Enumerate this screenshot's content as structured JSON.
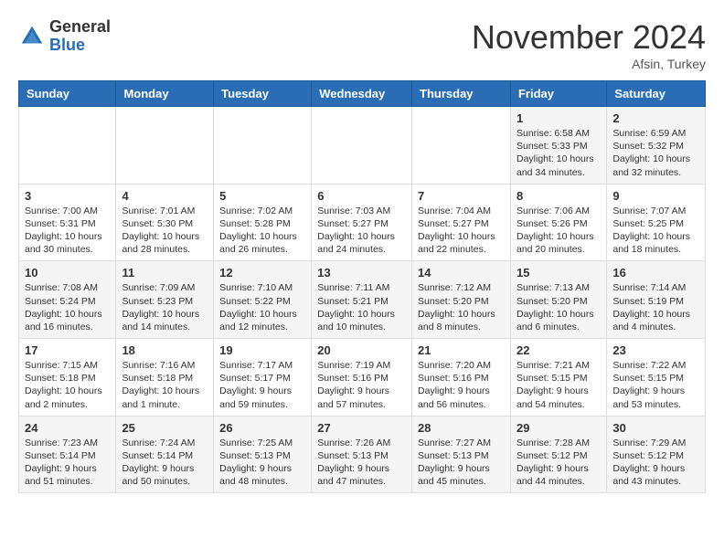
{
  "logo": {
    "general": "General",
    "blue": "Blue"
  },
  "header": {
    "month": "November 2024",
    "location": "Afsin, Turkey"
  },
  "days_of_week": [
    "Sunday",
    "Monday",
    "Tuesday",
    "Wednesday",
    "Thursday",
    "Friday",
    "Saturday"
  ],
  "weeks": [
    [
      {
        "day": "",
        "info": ""
      },
      {
        "day": "",
        "info": ""
      },
      {
        "day": "",
        "info": ""
      },
      {
        "day": "",
        "info": ""
      },
      {
        "day": "",
        "info": ""
      },
      {
        "day": "1",
        "info": "Sunrise: 6:58 AM\nSunset: 5:33 PM\nDaylight: 10 hours\nand 34 minutes."
      },
      {
        "day": "2",
        "info": "Sunrise: 6:59 AM\nSunset: 5:32 PM\nDaylight: 10 hours\nand 32 minutes."
      }
    ],
    [
      {
        "day": "3",
        "info": "Sunrise: 7:00 AM\nSunset: 5:31 PM\nDaylight: 10 hours\nand 30 minutes."
      },
      {
        "day": "4",
        "info": "Sunrise: 7:01 AM\nSunset: 5:30 PM\nDaylight: 10 hours\nand 28 minutes."
      },
      {
        "day": "5",
        "info": "Sunrise: 7:02 AM\nSunset: 5:28 PM\nDaylight: 10 hours\nand 26 minutes."
      },
      {
        "day": "6",
        "info": "Sunrise: 7:03 AM\nSunset: 5:27 PM\nDaylight: 10 hours\nand 24 minutes."
      },
      {
        "day": "7",
        "info": "Sunrise: 7:04 AM\nSunset: 5:27 PM\nDaylight: 10 hours\nand 22 minutes."
      },
      {
        "day": "8",
        "info": "Sunrise: 7:06 AM\nSunset: 5:26 PM\nDaylight: 10 hours\nand 20 minutes."
      },
      {
        "day": "9",
        "info": "Sunrise: 7:07 AM\nSunset: 5:25 PM\nDaylight: 10 hours\nand 18 minutes."
      }
    ],
    [
      {
        "day": "10",
        "info": "Sunrise: 7:08 AM\nSunset: 5:24 PM\nDaylight: 10 hours\nand 16 minutes."
      },
      {
        "day": "11",
        "info": "Sunrise: 7:09 AM\nSunset: 5:23 PM\nDaylight: 10 hours\nand 14 minutes."
      },
      {
        "day": "12",
        "info": "Sunrise: 7:10 AM\nSunset: 5:22 PM\nDaylight: 10 hours\nand 12 minutes."
      },
      {
        "day": "13",
        "info": "Sunrise: 7:11 AM\nSunset: 5:21 PM\nDaylight: 10 hours\nand 10 minutes."
      },
      {
        "day": "14",
        "info": "Sunrise: 7:12 AM\nSunset: 5:20 PM\nDaylight: 10 hours\nand 8 minutes."
      },
      {
        "day": "15",
        "info": "Sunrise: 7:13 AM\nSunset: 5:20 PM\nDaylight: 10 hours\nand 6 minutes."
      },
      {
        "day": "16",
        "info": "Sunrise: 7:14 AM\nSunset: 5:19 PM\nDaylight: 10 hours\nand 4 minutes."
      }
    ],
    [
      {
        "day": "17",
        "info": "Sunrise: 7:15 AM\nSunset: 5:18 PM\nDaylight: 10 hours\nand 2 minutes."
      },
      {
        "day": "18",
        "info": "Sunrise: 7:16 AM\nSunset: 5:18 PM\nDaylight: 10 hours\nand 1 minute."
      },
      {
        "day": "19",
        "info": "Sunrise: 7:17 AM\nSunset: 5:17 PM\nDaylight: 9 hours\nand 59 minutes."
      },
      {
        "day": "20",
        "info": "Sunrise: 7:19 AM\nSunset: 5:16 PM\nDaylight: 9 hours\nand 57 minutes."
      },
      {
        "day": "21",
        "info": "Sunrise: 7:20 AM\nSunset: 5:16 PM\nDaylight: 9 hours\nand 56 minutes."
      },
      {
        "day": "22",
        "info": "Sunrise: 7:21 AM\nSunset: 5:15 PM\nDaylight: 9 hours\nand 54 minutes."
      },
      {
        "day": "23",
        "info": "Sunrise: 7:22 AM\nSunset: 5:15 PM\nDaylight: 9 hours\nand 53 minutes."
      }
    ],
    [
      {
        "day": "24",
        "info": "Sunrise: 7:23 AM\nSunset: 5:14 PM\nDaylight: 9 hours\nand 51 minutes."
      },
      {
        "day": "25",
        "info": "Sunrise: 7:24 AM\nSunset: 5:14 PM\nDaylight: 9 hours\nand 50 minutes."
      },
      {
        "day": "26",
        "info": "Sunrise: 7:25 AM\nSunset: 5:13 PM\nDaylight: 9 hours\nand 48 minutes."
      },
      {
        "day": "27",
        "info": "Sunrise: 7:26 AM\nSunset: 5:13 PM\nDaylight: 9 hours\nand 47 minutes."
      },
      {
        "day": "28",
        "info": "Sunrise: 7:27 AM\nSunset: 5:13 PM\nDaylight: 9 hours\nand 45 minutes."
      },
      {
        "day": "29",
        "info": "Sunrise: 7:28 AM\nSunset: 5:12 PM\nDaylight: 9 hours\nand 44 minutes."
      },
      {
        "day": "30",
        "info": "Sunrise: 7:29 AM\nSunset: 5:12 PM\nDaylight: 9 hours\nand 43 minutes."
      }
    ]
  ]
}
